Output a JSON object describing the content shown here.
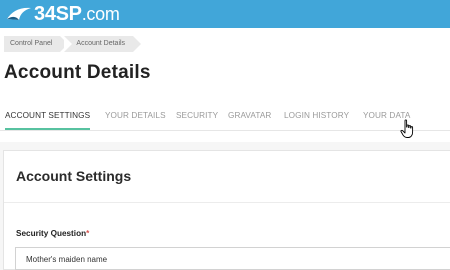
{
  "brand": {
    "name": "34SP",
    "tld": ".com"
  },
  "breadcrumb": [
    "Control Panel",
    "Account Details"
  ],
  "page_title": "Account Details",
  "tabs": [
    {
      "label": "ACCOUNT SETTINGS",
      "active": true
    },
    {
      "label": "YOUR DETAILS",
      "active": false
    },
    {
      "label": "SECURITY",
      "active": false
    },
    {
      "label": "GRAVATAR",
      "active": false
    },
    {
      "label": "LOGIN HISTORY",
      "active": false
    },
    {
      "label": "YOUR DATA",
      "active": false
    }
  ],
  "colors": {
    "topbar": "#41a6d9",
    "active_tab_underline": "#57c2a0",
    "required_marker": "#d9534f"
  },
  "cursor_icon": "hand-pointer-icon",
  "section": {
    "title": "Account Settings",
    "security_question": {
      "label": "Security Question",
      "required_marker": "*",
      "value": "Mother's maiden name"
    }
  }
}
